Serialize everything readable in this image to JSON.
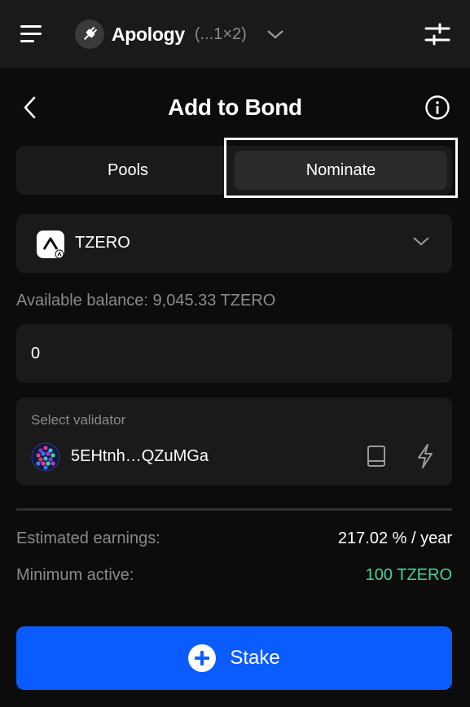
{
  "topbar": {
    "account_name": "Apology",
    "account_address": "(...1×2)"
  },
  "header": {
    "title": "Add to Bond"
  },
  "tabs": [
    {
      "label": "Pools",
      "active": false
    },
    {
      "label": "Nominate",
      "active": true
    }
  ],
  "token": {
    "name": "TZERO"
  },
  "balance": {
    "text": "Available balance: 9,045.33 TZERO"
  },
  "amount": {
    "value": "0"
  },
  "validator": {
    "label": "Select validator",
    "address": "5EHtnh…QZuMGa"
  },
  "summary": {
    "earnings_label": "Estimated earnings:",
    "earnings_value": "217.02 % / year",
    "minimum_label": "Minimum active:",
    "minimum_value": "100 TZERO"
  },
  "stake_button": {
    "label": "Stake"
  },
  "colors": {
    "background": "#0c0c0c",
    "card": "#1a1a1a",
    "accent": "#0a5cff",
    "positive": "#3fd49a",
    "muted_text": "#8a8a8a"
  },
  "icons": [
    "menu-icon",
    "plug-icon",
    "chevron-down-icon",
    "sliders-icon",
    "back-arrow-icon",
    "info-icon",
    "token-logo-icon",
    "identicon",
    "book-icon",
    "bolt-icon",
    "plus-circle-icon"
  ]
}
